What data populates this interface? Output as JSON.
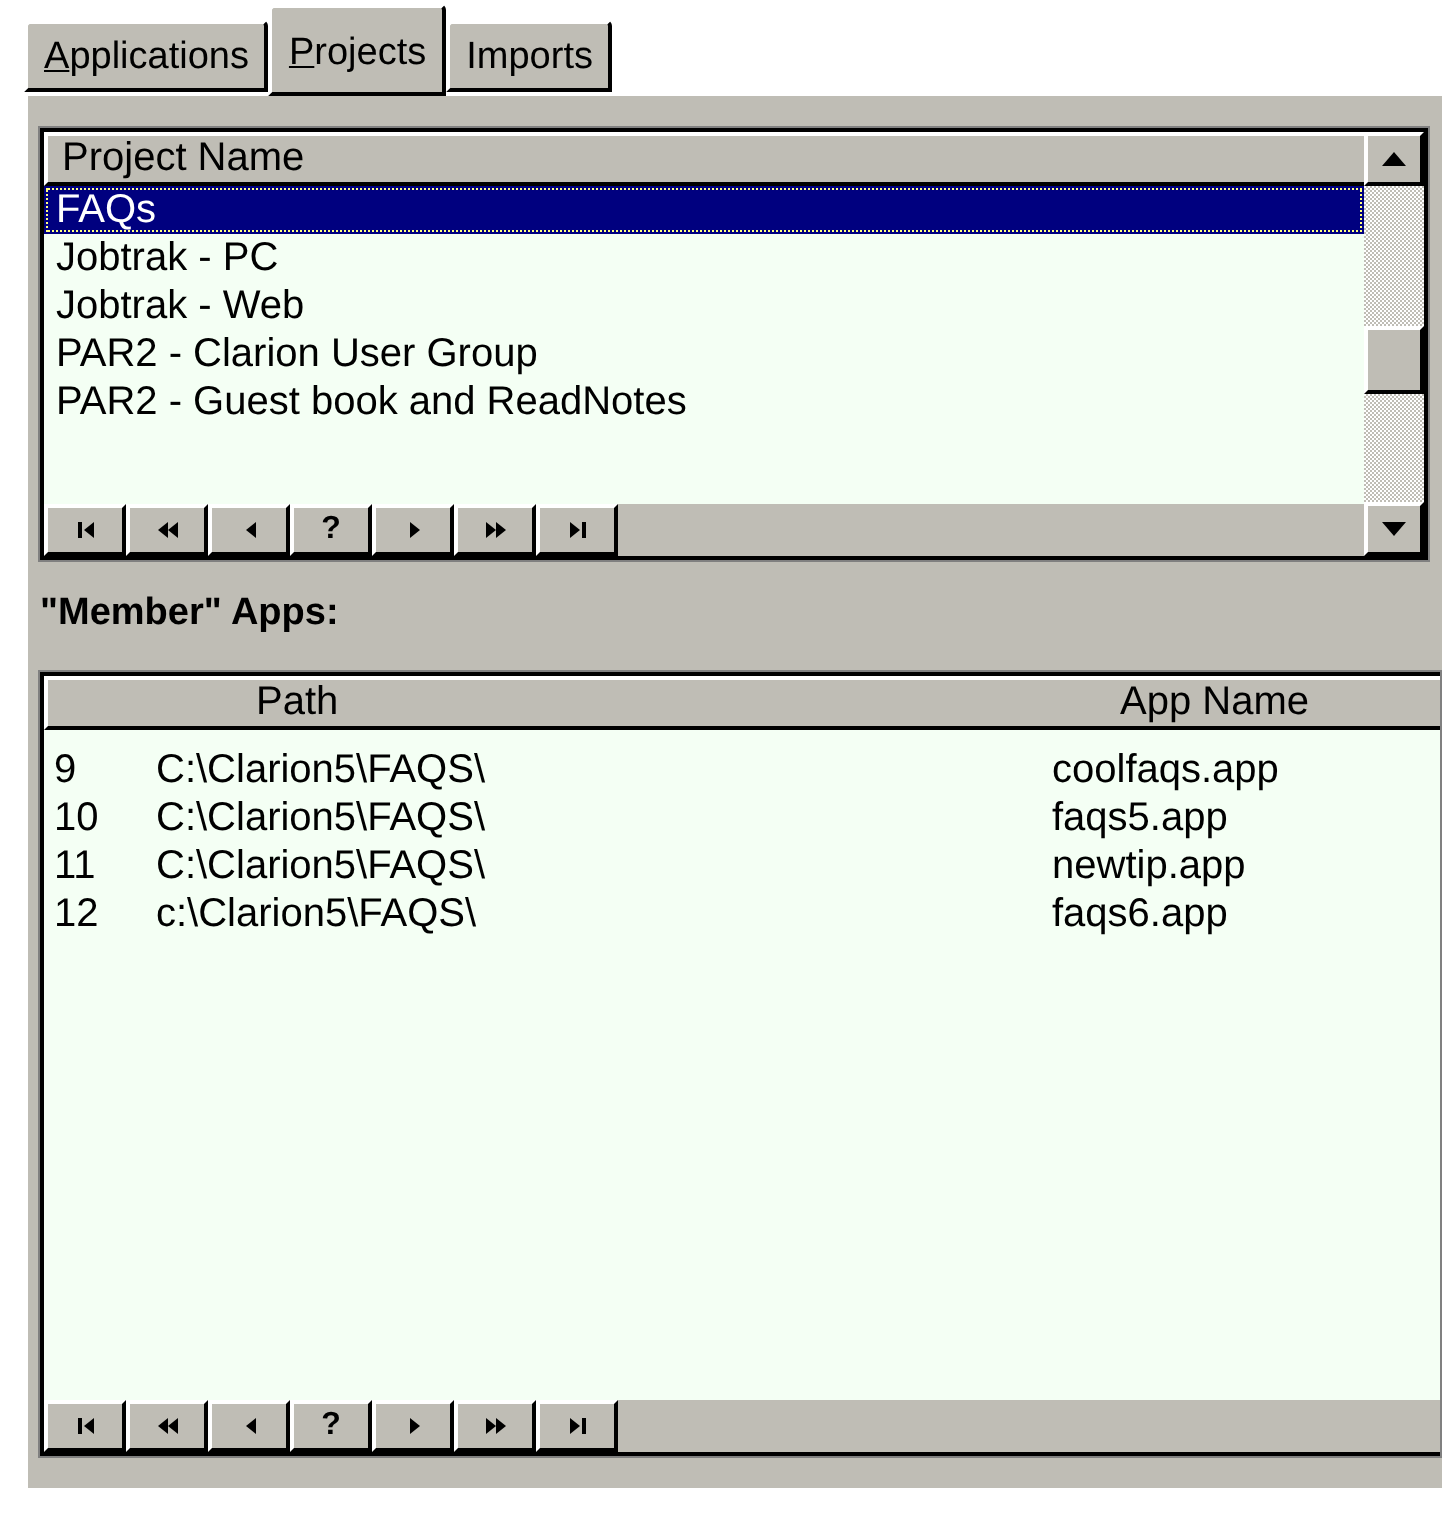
{
  "tabs": [
    {
      "label": "Applications",
      "underline_first": true,
      "selected": false
    },
    {
      "label": "Projects",
      "underline_first": true,
      "selected": true
    },
    {
      "label": "Imports",
      "selected": false
    }
  ],
  "projects": {
    "column": "Project Name",
    "rows": [
      {
        "name": "FAQs",
        "selected": true
      },
      {
        "name": "Jobtrak - PC",
        "selected": false
      },
      {
        "name": "Jobtrak - Web",
        "selected": false
      },
      {
        "name": "PAR2 - Clarion User Group",
        "selected": false
      },
      {
        "name": "PAR2 - Guest book and ReadNotes",
        "selected": false
      }
    ],
    "nav": [
      {
        "kind": "first"
      },
      {
        "kind": "page_back"
      },
      {
        "kind": "back"
      },
      {
        "kind": "query",
        "label": "?"
      },
      {
        "kind": "forward"
      },
      {
        "kind": "page_forward"
      },
      {
        "kind": "last"
      }
    ]
  },
  "member_apps": {
    "label": "\"Member\" Apps:",
    "columns": [
      "Path",
      "App Name"
    ],
    "rows": [
      {
        "number": "9",
        "path": "C:\\Clarion5\\FAQS\\",
        "app": "coolfaqs.app"
      },
      {
        "number": "10",
        "path": "C:\\Clarion5\\FAQS\\",
        "app": "faqs5.app"
      },
      {
        "number": "11",
        "path": "C:\\Clarion5\\FAQS\\",
        "app": "newtip.app"
      },
      {
        "number": "12",
        "path": "c:\\Clarion5\\FAQS\\",
        "app": "faqs6.app"
      }
    ],
    "nav": [
      {
        "kind": "first"
      },
      {
        "kind": "page_back"
      },
      {
        "kind": "back"
      },
      {
        "kind": "query",
        "label": "?"
      },
      {
        "kind": "forward"
      },
      {
        "kind": "page_forward"
      },
      {
        "kind": "last"
      }
    ]
  }
}
